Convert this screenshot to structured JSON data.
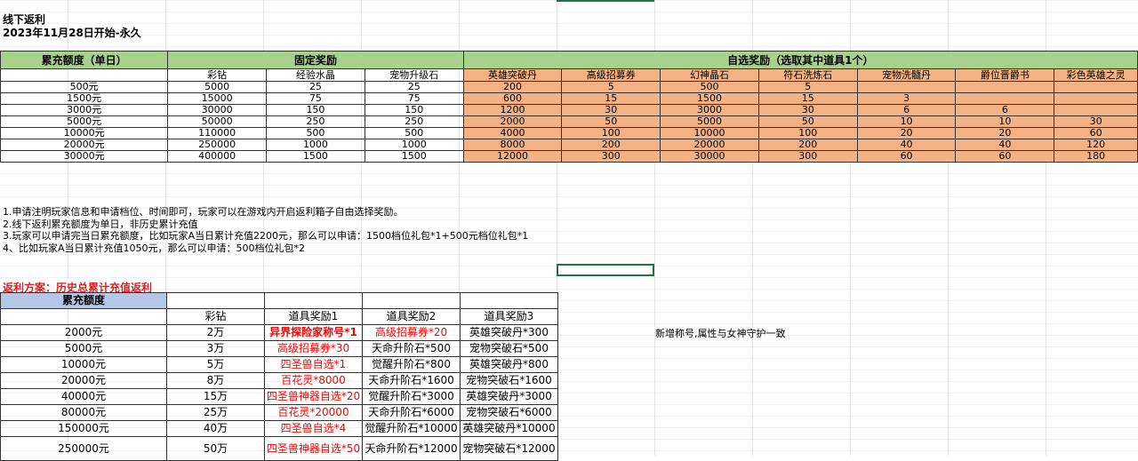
{
  "header": {
    "title": "线下返利",
    "date": "2023年11月28日开始-永久"
  },
  "table1": {
    "col1_header": "累充额度（单日）",
    "fixed_header": "固定奖励",
    "optional_header": "自选奖励（选取其中道具1个）",
    "fixed_cols": [
      "彩钻",
      "经验水晶",
      "宠物升级石"
    ],
    "optional_cols": [
      "英雄突破丹",
      "高级招募券",
      "幻神晶石",
      "符石洗炼石",
      "宠物洗髓丹",
      "爵位晋爵书",
      "彩色英雄之灵"
    ],
    "rows": [
      {
        "amount": "500元",
        "fixed": [
          "5000",
          "25",
          "25"
        ],
        "optional": [
          "200",
          "5",
          "500",
          "5",
          "",
          "",
          ""
        ]
      },
      {
        "amount": "1500元",
        "fixed": [
          "15000",
          "75",
          "75"
        ],
        "optional": [
          "600",
          "15",
          "1500",
          "15",
          "3",
          "",
          ""
        ]
      },
      {
        "amount": "3000元",
        "fixed": [
          "30000",
          "150",
          "150"
        ],
        "optional": [
          "1200",
          "30",
          "3000",
          "30",
          "6",
          "6",
          ""
        ]
      },
      {
        "amount": "5000元",
        "fixed": [
          "50000",
          "250",
          "250"
        ],
        "optional": [
          "2000",
          "50",
          "5000",
          "50",
          "10",
          "10",
          "30"
        ]
      },
      {
        "amount": "10000元",
        "fixed": [
          "110000",
          "500",
          "500"
        ],
        "optional": [
          "4000",
          "100",
          "10000",
          "100",
          "20",
          "20",
          "60"
        ]
      },
      {
        "amount": "20000元",
        "fixed": [
          "250000",
          "1000",
          "1000"
        ],
        "optional": [
          "8000",
          "200",
          "20000",
          "200",
          "40",
          "40",
          "120"
        ]
      },
      {
        "amount": "30000元",
        "fixed": [
          "400000",
          "1500",
          "1500"
        ],
        "optional": [
          "12000",
          "300",
          "30000",
          "300",
          "60",
          "60",
          "180"
        ]
      }
    ]
  },
  "notes": [
    "1.申请注明玩家信息和申请档位、时间即可，玩家可以在游戏内开启返利箱子自由选择奖励。",
    "2.线下返利累充额度为单日，非历史累计充值",
    "3.玩家可以申请完当日累充额度，比如玩家A当日累计充值2200元，那么可以申请：1500档位礼包*1+500元档位礼包*1",
    "4、比如玩家A当日累计充值1050元，那么可以申请：500档位礼包*2"
  ],
  "plan": {
    "title": "返利方案：历史总累计充值返利",
    "col_header": "累充额度",
    "sub_headers": [
      "彩钻",
      "道具奖励1",
      "道具奖励2",
      "道具奖励3"
    ],
    "rows": [
      {
        "amount": "2000元",
        "diamond": "2万",
        "item1": "异界探险家称号*1",
        "item2": "高级招募券*20",
        "item3": "英雄突破丹*300"
      },
      {
        "amount": "5000元",
        "diamond": "3万",
        "item1": "高级招募券*30",
        "item2": "天命升阶石*500",
        "item3": "宠物突破石*500"
      },
      {
        "amount": "10000元",
        "diamond": "5万",
        "item1": "四圣兽自选*1",
        "item2": "觉醒升阶石*800",
        "item3": "英雄突破丹*800"
      },
      {
        "amount": "20000元",
        "diamond": "8万",
        "item1": "百花灵*8000",
        "item2": "天命升阶石*1600",
        "item3": "宠物突破石*1600"
      },
      {
        "amount": "40000元",
        "diamond": "15万",
        "item1": "四圣兽神器自选*20",
        "item2": "觉醒升阶石*3000",
        "item3": "英雄突破丹*3000"
      },
      {
        "amount": "80000元",
        "diamond": "25万",
        "item1": "百花灵*20000",
        "item2": "天命升阶石*6000",
        "item3": "宠物突破石*6000"
      },
      {
        "amount": "150000元",
        "diamond": "40万",
        "item1": "四圣兽自选*4",
        "item2": "觉醒升阶石*10000",
        "item3": "英雄突破丹*10000"
      },
      {
        "amount": "250000元",
        "diamond": "50万",
        "item1": "四圣兽神器自选*50",
        "item2": "天命升阶石*12000",
        "item3": "宠物突破石*12000"
      }
    ],
    "side_note": "新增称号,属性与女神守护一致"
  }
}
